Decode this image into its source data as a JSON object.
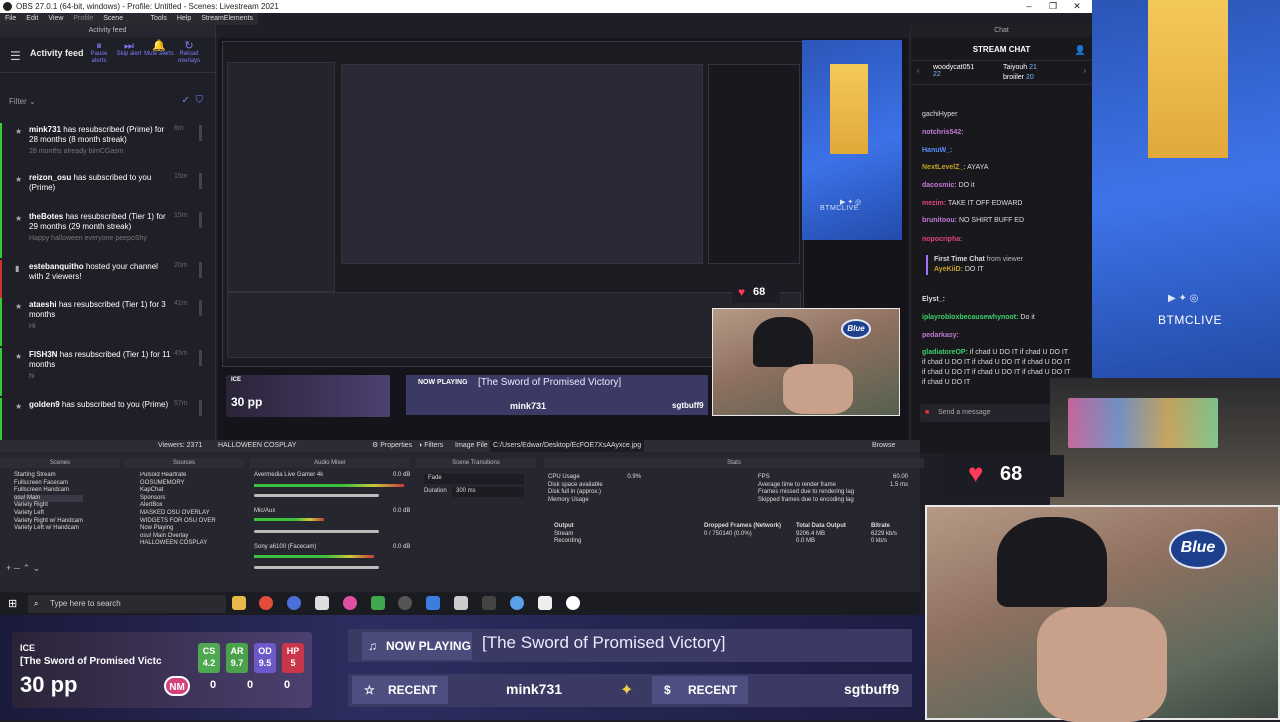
{
  "window": {
    "title": "OBS 27.0.1 (64-bit, windows) - Profile: Untitled - Scenes: Livestream 2021",
    "controls": [
      "–",
      "❐",
      "✕"
    ]
  },
  "menu": [
    "File",
    "Edit",
    "View",
    "Profile",
    "Scene Collection",
    "Tools",
    "Help",
    "StreamElements"
  ],
  "activity_feed": {
    "dock_title": "Activity feed",
    "title": "Activity feed",
    "tools": [
      {
        "label": "Pause alerts",
        "icon": "pause-icon"
      },
      {
        "label": "Skip alert",
        "icon": "skip-icon"
      },
      {
        "label": "Mute alerts",
        "icon": "bell-icon"
      },
      {
        "label": "Reload overlays",
        "icon": "reload-icon"
      }
    ],
    "filter_label": "Filter",
    "items": [
      {
        "user": "mink731",
        "action": "has resubscribed (Prime) for 28 months (8 month streak)",
        "message": "28 months already bimCGasm",
        "time": "6m"
      },
      {
        "user": "reizon_osu",
        "action": "has subscribed to you (Prime)",
        "message": "",
        "time": "15m"
      },
      {
        "user": "theBotes",
        "action": "has resubscribed (Tier 1) for 29 months (29 month streak)",
        "message": "Happy halloween everyone peepoShy",
        "time": "15m"
      },
      {
        "user": "estebanquitho",
        "action": "hosted your channel with 2 viewers!",
        "message": "",
        "time": "20m"
      },
      {
        "user": "ataeshi",
        "action": "has resubscribed (Tier 1) for 3 months",
        "message": "Hi",
        "time": "41m"
      },
      {
        "user": "FISH3N",
        "action": "has resubscribed (Tier 1) for 11 months",
        "message": "hi",
        "time": "45m"
      },
      {
        "user": "golden9",
        "action": "has subscribed to you (Prime)",
        "message": "",
        "time": "57m"
      }
    ],
    "footer_letters": "A  A"
  },
  "status": {
    "viewers": "Viewers: 2371",
    "source_name": "HALLOWEEN COSPLAY",
    "properties": "Properties",
    "filters": "Filters",
    "image_file_label": "Image File",
    "image_path": "C:/Users/Edwar/Desktop/EcFOE7XsAAyxce.jpg",
    "browse": "Browse"
  },
  "chat": {
    "dock_title": "Chat",
    "title": "STREAM CHAT",
    "gifters": [
      {
        "name": "woodycat051",
        "count": "22"
      },
      {
        "name": "Taiyouh",
        "count": "21"
      },
      {
        "name": "broiiler",
        "count": "20"
      }
    ],
    "messages": [
      {
        "user": "",
        "text": "gachiHyper",
        "color": "#dddddd"
      },
      {
        "user": "notchris542:",
        "text": "",
        "color": "#c27ad6"
      },
      {
        "user": "HanuW_:",
        "text": "",
        "color": "#5a8cff"
      },
      {
        "user": "NextLevelZ_:",
        "text": "AYAYA",
        "color": "#c9a227"
      },
      {
        "user": "dacosmic:",
        "text": "DO it",
        "color": "#c27ad6"
      },
      {
        "user": "mezim:",
        "text": "TAKE IT OFF EDWARD",
        "color": "#e0457b"
      },
      {
        "user": "brunitoou:",
        "text": "NO SHIRT BUFF ED",
        "color": "#c27ad6"
      },
      {
        "user": "nopocripha:",
        "text": "",
        "color": "#e0457b"
      },
      {
        "user": "First Time Chat",
        "text": "from viewer",
        "color": "#ffffff"
      },
      {
        "user": "AyeKiiD:",
        "text": "DO IT",
        "color": "#c9a227"
      },
      {
        "user": "Elyst_:",
        "text": "",
        "color": "#dddddd"
      },
      {
        "user": "iplayrobloxbecausewhynoot:",
        "text": "Do it",
        "color": "#3ccf6a"
      },
      {
        "user": "pedarkasy:",
        "text": "",
        "color": "#c27ad6"
      },
      {
        "user": "gladiatoreOP:",
        "text": "if chad U DO IT if chad U DO IT if chad U DO IT if chad U DO IT if chad U DO IT if chad U DO IT if chad U DO IT if chad U DO IT if chad U DO IT",
        "color": "#3ccf6a"
      }
    ],
    "input_placeholder": "Send a message"
  },
  "branding": {
    "channel": "BTMCLIVE",
    "channel_small": "BTMCLIVE"
  },
  "docks": {
    "scenes_title": "Scenes",
    "scenes": [
      "Starting Stream",
      "Fullscreen Facecam",
      "Fullscreen Handcam",
      "osu! Main",
      "Variety Right",
      "Variety Left",
      "Variety Right w/ Handcam",
      "Variety Left w/ Handcam"
    ],
    "sources_title": "Sources",
    "sources": [
      "Pulsoid Heartrate",
      "GOSUMEMORY",
      "KapChat",
      "Sponsors",
      "AlertBox",
      "MASKED OSU OVERLAY",
      "WIDGETS FOR OSU OVER",
      "Now Playing",
      "osu! Main Overlay",
      "HALLOWEEN COSPLAY"
    ],
    "mixer_title": "Audio Mixer",
    "mixer": [
      {
        "name": "Avermedia Live Gamer 4k",
        "db": "0.0 dB"
      },
      {
        "name": "Mic/Aux",
        "db": "0.0 dB"
      },
      {
        "name": "Sony a6100 (Facecam)",
        "db": "0.0 dB"
      }
    ],
    "transitions_title": "Scene Transitions",
    "transition": "Fade",
    "duration_label": "Duration",
    "duration": "300 ms",
    "stats_title": "Stats",
    "stats": {
      "cpu_label": "CPU Usage",
      "cpu": "0.9%",
      "disk_label": "Disk space available",
      "disk": "",
      "full_label": "Disk full in (approx.)",
      "mem_label": "Memory Usage",
      "fps_label": "FPS",
      "fps": "60.00",
      "render_label": "Average time to render frame",
      "render": "1.5 ms",
      "missed_label": "Frames missed due to rendering lag",
      "missed": "0 / 754802 (0.0%)",
      "skipped_label": "Skipped frames due to encoding lag",
      "skipped": "0 / 750152 (0.0%)",
      "cols": [
        "Output",
        "Dropped Frames (Network)",
        "Total Data Output",
        "Bitrate"
      ],
      "rows": [
        {
          "name": "Stream",
          "dropped": "0 / 750140 (0.0%)",
          "total": "9206.4 MB",
          "bitrate": "6229 kb/s"
        },
        {
          "name": "Recording",
          "dropped": "",
          "total": "0.0 MB",
          "bitrate": "0 kb/s"
        }
      ]
    }
  },
  "taskbar": {
    "search_placeholder": "Type here to search"
  },
  "overlay": {
    "player": "ICE",
    "song": "[The Sword of Promised Victc",
    "pp": "30 pp",
    "stats": [
      {
        "label": "CS",
        "value": "4.2",
        "color": "#4fa84f"
      },
      {
        "label": "AR",
        "value": "9.7",
        "color": "#4aa34a"
      },
      {
        "label": "OD",
        "value": "9.5",
        "color": "#6c58c9"
      },
      {
        "label": "HP",
        "value": "5",
        "color": "#c9364a"
      }
    ],
    "mod": "NM",
    "misses": [
      "0",
      "0",
      "0"
    ],
    "now_playing_label": "NOW PLAYING",
    "now_playing_song": "[The Sword of Promised Victory]",
    "recent_label_1": "RECENT",
    "recent_user_1": "mink731",
    "recent_label_2": "RECENT",
    "recent_user_2": "sgtbuff9"
  },
  "heart": {
    "bpm": "68"
  },
  "camera": {
    "brand": "Blue"
  },
  "colors": {
    "accent": "#7c7cf5",
    "obs_bg": "#26262e",
    "overlay_bg": "#2d2d60",
    "heart": "#ff3b5c",
    "brand_blue": "#3e74ea"
  }
}
